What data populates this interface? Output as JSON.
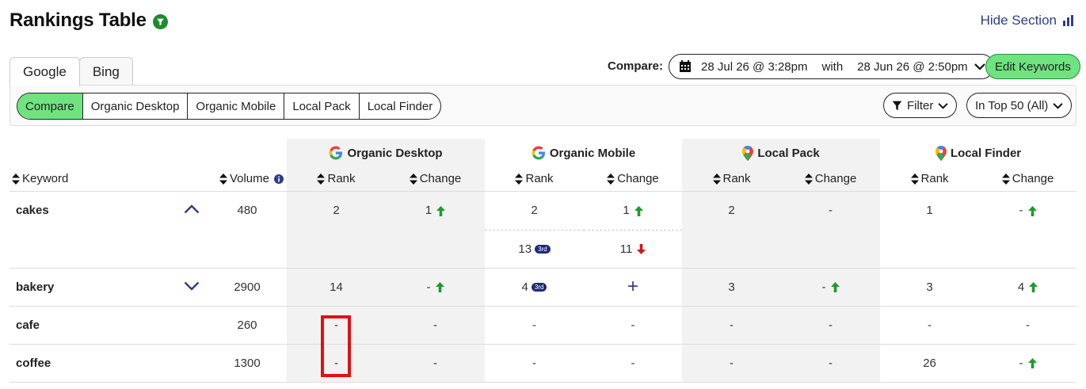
{
  "header": {
    "title": "Rankings Table",
    "hide_section": "Hide Section"
  },
  "engine_tabs": [
    "Google",
    "Bing"
  ],
  "view_tabs": [
    "Compare",
    "Organic Desktop",
    "Organic Mobile",
    "Local Pack",
    "Local Finder"
  ],
  "compare": {
    "label": "Compare:",
    "date_from": "28 Jul 26 @ 3:28pm",
    "with": "with",
    "date_to": "28 Jun 26 @ 2:50pm",
    "edit_keywords": "Edit Keywords"
  },
  "filters": {
    "filter_label": "Filter",
    "top_label": "In Top 50 (All)"
  },
  "table": {
    "groups": [
      "Organic Desktop",
      "Organic Mobile",
      "Local Pack",
      "Local Finder"
    ],
    "headers": {
      "keyword": "Keyword",
      "volume": "Volume",
      "rank": "Rank",
      "change": "Change"
    },
    "rows": [
      {
        "keyword": "cakes",
        "volume": "480",
        "od_rank": "2",
        "od_change": "1",
        "om_rank": "2",
        "om_change": "1",
        "lp_rank": "2",
        "lp_change": "-",
        "lf_rank": "1",
        "lf_change": "-"
      },
      {
        "om_rank": "13",
        "om_badge": "3rd",
        "om_change": "11"
      },
      {
        "keyword": "bakery",
        "volume": "2900",
        "od_rank": "14",
        "od_change": "-",
        "om_rank": "4",
        "om_badge": "3rd",
        "om_change": "+",
        "lp_rank": "3",
        "lp_change": "-",
        "lf_rank": "3",
        "lf_change": "4"
      },
      {
        "keyword": "cafe",
        "volume": "260",
        "od_rank": "-",
        "od_change": "-",
        "om_rank": "-",
        "om_change": "-",
        "lp_rank": "-",
        "lp_change": "-",
        "lf_rank": "-",
        "lf_change": "-"
      },
      {
        "keyword": "coffee",
        "volume": "1300",
        "od_rank": "-",
        "od_change": "-",
        "om_rank": "-",
        "om_change": "-",
        "lp_rank": "-",
        "lp_change": "-",
        "lf_rank": "26",
        "lf_change": "-"
      }
    ]
  },
  "colors": {
    "accent_green": "#6ee37f",
    "up_arrow": "#1e9a2e",
    "down_arrow": "#d01818",
    "link_blue": "#2e3d8e",
    "highlight_red": "#e31010"
  }
}
